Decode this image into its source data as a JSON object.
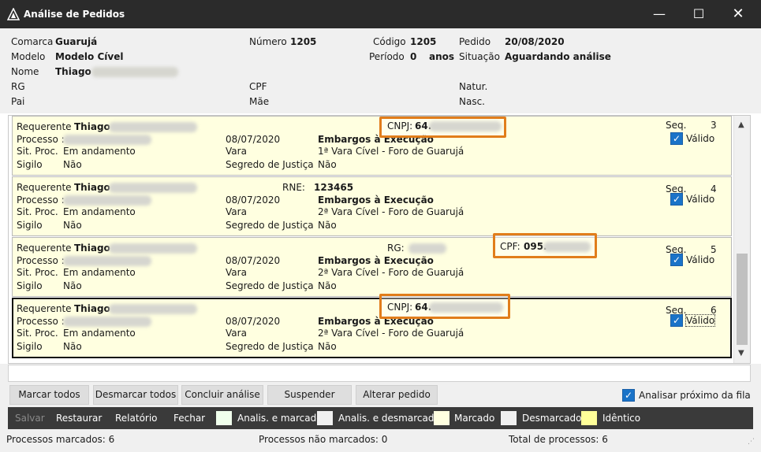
{
  "window": {
    "title": "Análise de Pedidos",
    "minimize": "—",
    "maximize": "☐",
    "close": "✕"
  },
  "header": {
    "comarca_label": "Comarca",
    "comarca_value": "Guarujá",
    "numero_label": "Número",
    "numero_value": "1205",
    "codigo_label": "Código",
    "codigo_value": "1205",
    "pedido_label": "Pedido",
    "pedido_value": "20/08/2020",
    "modelo_label": "Modelo",
    "modelo_value": "Modelo Cível",
    "periodo_label": "Período",
    "periodo_value": "0",
    "periodo_unit": "anos",
    "situacao_label": "Situação",
    "situacao_value": "Aguardando análise",
    "nome_label": "Nome",
    "nome_value": "Thiago",
    "rg_label": "RG",
    "cpf_label": "CPF",
    "natur_label": "Natur.",
    "pai_label": "Pai",
    "mae_label": "Mãe",
    "nasc_label": "Nasc."
  },
  "cards": [
    {
      "requerente_label": "Requerente",
      "requerente_value": "Thiago",
      "processo_label": "Processo :",
      "date": "08/07/2020",
      "acao": "Embargos à Execução",
      "sit_label": "Sit. Proc.",
      "sit_value": "Em andamento",
      "vara_label": "Vara",
      "vara_value": "1ª Vara Cível - Foro de Guarujá",
      "sigilo_label": "Sigilo",
      "sigilo_value": "Não",
      "segredo_label": "Segredo de Justiça",
      "segredo_value": "Não",
      "doc_label": "CNPJ:",
      "doc_value": "64.",
      "seq_label": "Seq.",
      "seq_value": "3",
      "valido_label": "Válido"
    },
    {
      "requerente_label": "Requerente",
      "requerente_value": "Thiago",
      "processo_label": "Processo :",
      "date": "08/07/2020",
      "acao": "Embargos à Execução",
      "sit_label": "Sit. Proc.",
      "sit_value": "Em andamento",
      "vara_label": "Vara",
      "vara_value": "2ª Vara Cível - Foro de Guarujá",
      "sigilo_label": "Sigilo",
      "sigilo_value": "Não",
      "segredo_label": "Segredo de Justiça",
      "segredo_value": "Não",
      "doc_label": "RNE:",
      "doc_value": "123465",
      "seq_label": "Seq.",
      "seq_value": "4",
      "valido_label": "Válido"
    },
    {
      "requerente_label": "Requerente",
      "requerente_value": "Thiago",
      "processo_label": "Processo :",
      "date": "08/07/2020",
      "acao": "Embargos à Execução",
      "sit_label": "Sit. Proc.",
      "sit_value": "Em andamento",
      "vara_label": "Vara",
      "vara_value": "2ª Vara Cível - Foro de Guarujá",
      "sigilo_label": "Sigilo",
      "sigilo_value": "Não",
      "segredo_label": "Segredo de Justiça",
      "segredo_value": "Não",
      "rg_label": "RG:",
      "doc_label": "CPF:",
      "doc_value": "095.",
      "seq_label": "Seq.",
      "seq_value": "5",
      "valido_label": "Válido"
    },
    {
      "requerente_label": "Requerente",
      "requerente_value": "Thiago",
      "processo_label": "Processo :",
      "date": "08/07/2020",
      "acao": "Embargos à Execução",
      "sit_label": "Sit. Proc.",
      "sit_value": "Em andamento",
      "vara_label": "Vara",
      "vara_value": "2ª Vara Cível - Foro de Guarujá",
      "sigilo_label": "Sigilo",
      "sigilo_value": "Não",
      "segredo_label": "Segredo de Justiça",
      "segredo_value": "Não",
      "doc_label": "CNPJ:",
      "doc_value": "64.",
      "seq_label": "Seq.",
      "seq_value": "6",
      "valido_label": "Válido"
    }
  ],
  "buttons": {
    "marcar_todos": "Marcar todos",
    "desmarcar_todos": "Desmarcar todos",
    "concluir": "Concluir análise",
    "suspender": "Suspender",
    "alterar": "Alterar pedido",
    "analisar_proximo": "Analisar próximo da fila"
  },
  "legend": {
    "salvar": "Salvar",
    "restaurar": "Restaurar",
    "relatorio": "Relatório",
    "fechar": "Fechar",
    "analis_marcado": "Analis. e marcado",
    "analis_desmarcado": "Analis. e desmarcado",
    "marcado": "Marcado",
    "desmarcado": "Desmarcado",
    "identico": "Idêntico",
    "colors": {
      "analis_marcado": "#f0ffec",
      "analis_desmarcado": "#f0f0f0",
      "marcado": "#ffffe0",
      "desmarcado": "#f0f0f0",
      "identico": "#ffff99"
    }
  },
  "status": {
    "marcados": "Processos marcados: 6",
    "nao_marcados": "Processos não marcados: 0",
    "total": "Total de processos: 6"
  },
  "colors": {
    "highlight_border": "#e17d1b",
    "card_bg": "#ffffe0",
    "checkbox": "#1a73c8"
  }
}
